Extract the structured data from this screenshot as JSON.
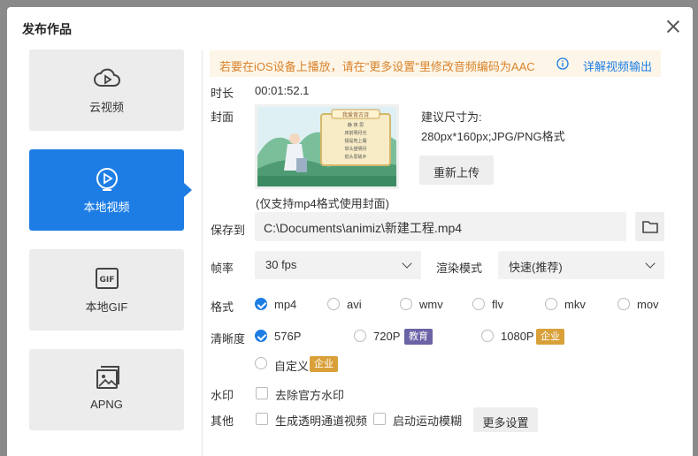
{
  "dialog": {
    "title": "发布作品"
  },
  "sidebar": {
    "items": [
      {
        "label": "云视频",
        "icon": "cloud-play-icon"
      },
      {
        "label": "本地视频",
        "icon": "play-circle-icon"
      },
      {
        "label": "本地GIF",
        "icon": "gif-icon"
      },
      {
        "label": "APNG",
        "icon": "image-icon"
      }
    ]
  },
  "notice": {
    "text": "若要在iOS设备上播放，请在\"更多设置\"里修改音频编码为AAC",
    "link": "详解视频输出"
  },
  "duration": {
    "label": "时长",
    "value": "00:01:52.1"
  },
  "cover": {
    "label": "封面",
    "hint_title": "建议尺寸为:",
    "hint_size": "280px*160px;JPG/PNG格式",
    "reupload": "重新上传",
    "note": "(仅支持mp4格式使用封面)",
    "thumb_title": "我爱背古诗",
    "thumb_lines": [
      "静 夜 思",
      "床前明月光",
      "疑是地上霜",
      "举头望明月",
      "低头思故乡"
    ]
  },
  "save": {
    "label": "保存到",
    "path": "C:\\Documents\\animiz\\新建工程.mp4"
  },
  "fps": {
    "label": "帧率",
    "value": "30 fps"
  },
  "render": {
    "label": "渲染模式",
    "value": "快速(推荐)"
  },
  "format": {
    "label": "格式",
    "options": [
      "mp4",
      "avi",
      "wmv",
      "flv",
      "mkv",
      "mov"
    ],
    "selected": "mp4"
  },
  "quality": {
    "label": "清晰度",
    "options": [
      "576P",
      "720P",
      "1080P",
      "自定义"
    ],
    "badges": {
      "edu": "教育",
      "ent": "企业"
    },
    "selected": "576P"
  },
  "watermark": {
    "label": "水印",
    "option": "去除官方水印"
  },
  "other": {
    "label": "其他",
    "alpha": "生成透明通道视频",
    "blur": "启动运动模糊",
    "more": "更多设置"
  },
  "colors": {
    "accent": "#1d7de5",
    "notice_text": "#d9822b",
    "edu_badge": "#6a63a6",
    "ent_badge": "#d9a03a"
  }
}
